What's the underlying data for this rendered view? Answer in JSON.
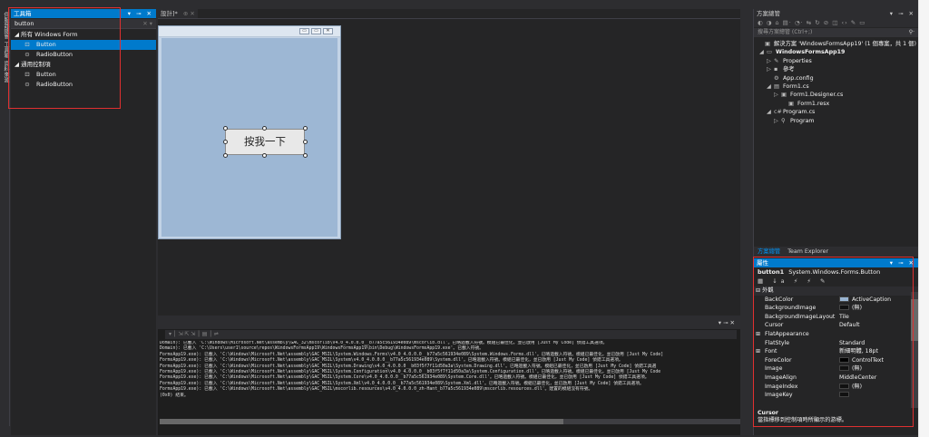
{
  "left_rail": {
    "tabs": [
      "伺服器總管",
      "工具箱",
      "資料來源"
    ]
  },
  "toolbox": {
    "title": "工具箱",
    "title_buttons": "▾ ⊸ ✕",
    "search_value": "button",
    "search_clear": "✕ ▾",
    "group_all": "◢ 所有 Windows Form",
    "group_common": "◢ 通用控制項",
    "all_items": [
      {
        "icon": "⊡",
        "label": "Button",
        "selected": true
      },
      {
        "icon": "⊙",
        "label": "RadioButton",
        "selected": false
      }
    ],
    "common_items": [
      {
        "icon": "⊡",
        "label": "Button"
      },
      {
        "icon": "⊙",
        "label": "RadioButton"
      }
    ]
  },
  "document_tab": {
    "label": "設計]*",
    "controls": "⊕ ✕"
  },
  "form": {
    "window_buttons": [
      "▭",
      "▭",
      "✕"
    ],
    "button_text": "按我一下"
  },
  "output": {
    "panel_controls": "▾ ⊸ ✕",
    "toolbar": "▾ │ ⇲ ⇱ ⇲ │ ▤ │ ⇌",
    "lines": [
      "Domain): 已載入 'C:\\Windows\\Microsoft.Net\\assembly\\GAC_32\\mscorlib\\v4.0_4.0.0.0__b77a5c561934e089\\mscorlib.dll'。已略過載入符號。模組已最佳化，並已啟用 [Just My Code] 偵錯工具選項。",
      "Domain): 已載入 'C:\\Users\\user1\\source\\repos\\WindowsFormsApp19\\WindowsFormsApp19\\bin\\Debug\\WindowsFormsApp19.exe'。已載入符號。",
      "FormsApp19.exe): 已載入 'C:\\Windows\\Microsoft.Net\\assembly\\GAC_MSIL\\System.Windows.Forms\\v4.0_4.0.0.0__b77a5c561934e089\\System.Windows.Forms.dll'。已略過載入符號。模組已最佳化，並已啟用 [Just My Code]",
      "FormsApp19.exe): 已載入 'C:\\Windows\\Microsoft.Net\\assembly\\GAC_MSIL\\System\\v4.0_4.0.0.0__b77a5c561934e089\\System.dll'。已略過載入符號。模組已最佳化，並已啟用 [Just My Code] 偵錯工具選項。",
      "FormsApp19.exe): 已載入 'C:\\Windows\\Microsoft.Net\\assembly\\GAC_MSIL\\System.Drawing\\v4.0_4.0.0.0__b03f5f7f11d50a3a\\System.Drawing.dll'。已略過載入符號。模組已最佳化，並已啟用 [Just My Code] 偵錯工具選",
      "FormsApp19.exe): 已載入 'C:\\Windows\\Microsoft.Net\\assembly\\GAC_MSIL\\System.Configuration\\v4.0_4.0.0.0__b03f5f7f11d50a3a\\System.Configuration.dll'。已略過載入符號。模組已最佳化，並已啟用 [Just My Code",
      "FormsApp19.exe): 已載入 'C:\\Windows\\Microsoft.Net\\assembly\\GAC_MSIL\\System.Core\\v4.0_4.0.0.0__b77a5c561934e089\\System.Core.dll'。已略過載入符號。模組已最佳化，並已啟用 [Just My Code] 偵錯工具選項。",
      "FormsApp19.exe): 已載入 'C:\\Windows\\Microsoft.Net\\assembly\\GAC_MSIL\\System.Xml\\v4.0_4.0.0.0__b77a5c561934e089\\System.Xml.dll'。已略過載入符號。模組已最佳化，並已啟用 [Just My Code] 偵錯工具選項。",
      "FormsApp19.exe): 已載入 'C:\\Windows\\Microsoft.Net\\assembly\\GAC_MSIL\\mscorlib.resources\\v4.0_4.0.0.0_zh-Hant_b77a5c561934e089\\mscorlib.resources.dll'。建置的模組沒有符號。",
      "(0x0) 結束。"
    ]
  },
  "solution_explorer": {
    "title": "方案總管",
    "title_buttons": "▾ ⊸ ✕",
    "toolbar": "◐ ◑ ⌂ ▤· ◔· ⇆ ↻ ⊘ ◫ ‹› ✎ ▭",
    "search_placeholder": "搜尋方案總管 (Ctrl+;)",
    "search_icon": "⚲·",
    "tree": [
      {
        "indent": 4,
        "arrow": "",
        "icon": "▣",
        "label": "解決方案 'WindowsFormsApp19' (1 個專案，共 1 個)",
        "bold": false
      },
      {
        "indent": 6,
        "arrow": "◢",
        "icon": "▭",
        "label": "WindowsFormsApp19",
        "bold": true
      },
      {
        "indent": 14,
        "arrow": "▷",
        "icon": "✎",
        "label": "Properties",
        "bold": false
      },
      {
        "indent": 14,
        "arrow": "▷",
        "icon": "▪",
        "label": "參考",
        "bold": false
      },
      {
        "indent": 14,
        "arrow": "",
        "icon": "⚙",
        "label": "App.config",
        "bold": false
      },
      {
        "indent": 14,
        "arrow": "◢",
        "icon": "▤",
        "label": "Form1.cs",
        "bold": false
      },
      {
        "indent": 22,
        "arrow": "▷",
        "icon": "▣",
        "label": "Form1.Designer.cs",
        "bold": false
      },
      {
        "indent": 30,
        "arrow": "",
        "icon": "▣",
        "label": "Form1.resx",
        "bold": false
      },
      {
        "indent": 14,
        "arrow": "◢",
        "icon": "c#",
        "label": "Program.cs",
        "bold": false
      },
      {
        "indent": 22,
        "arrow": "▷",
        "icon": "⚲",
        "label": "Program",
        "bold": false
      }
    ],
    "tabs": [
      "方案總管",
      "Team Explorer"
    ]
  },
  "properties": {
    "title": "屬性",
    "title_buttons": "▾ ⊸ ✕",
    "object_name": "button1",
    "object_type": "System.Windows.Forms.Button",
    "toolbar": "▦ ↓a ⚡ ⚡ ✎",
    "category_appearance": "⊟ 外觀",
    "rows": [
      {
        "name": "BackColor",
        "value": "ActiveCaption",
        "swatch": "#99b4d1"
      },
      {
        "name": "BackgroundImage",
        "value": "(無)",
        "swatch": "#111111"
      },
      {
        "name": "BackgroundImageLayout",
        "value": "Tile",
        "swatch": ""
      },
      {
        "name": "Cursor",
        "value": "Default",
        "swatch": ""
      },
      {
        "name": "FlatAppearance",
        "value": "",
        "swatch": "",
        "expander": "⊞"
      },
      {
        "name": "FlatStyle",
        "value": "Standard",
        "swatch": ""
      },
      {
        "name": "Font",
        "value": "新細明體, 18pt",
        "swatch": "",
        "expander": "⊞"
      },
      {
        "name": "ForeColor",
        "value": "ControlText",
        "swatch": "#000000"
      },
      {
        "name": "Image",
        "value": "(無)",
        "swatch": "#111111"
      },
      {
        "name": "ImageAlign",
        "value": "MiddleCenter",
        "swatch": ""
      },
      {
        "name": "ImageIndex",
        "value": "(無)",
        "swatch": "#111111"
      },
      {
        "name": "ImageKey",
        "value": "",
        "swatch": "#111111"
      }
    ],
    "desc_title": "Cursor",
    "desc_text": "當指標移到控制項時所顯示的游標。"
  }
}
